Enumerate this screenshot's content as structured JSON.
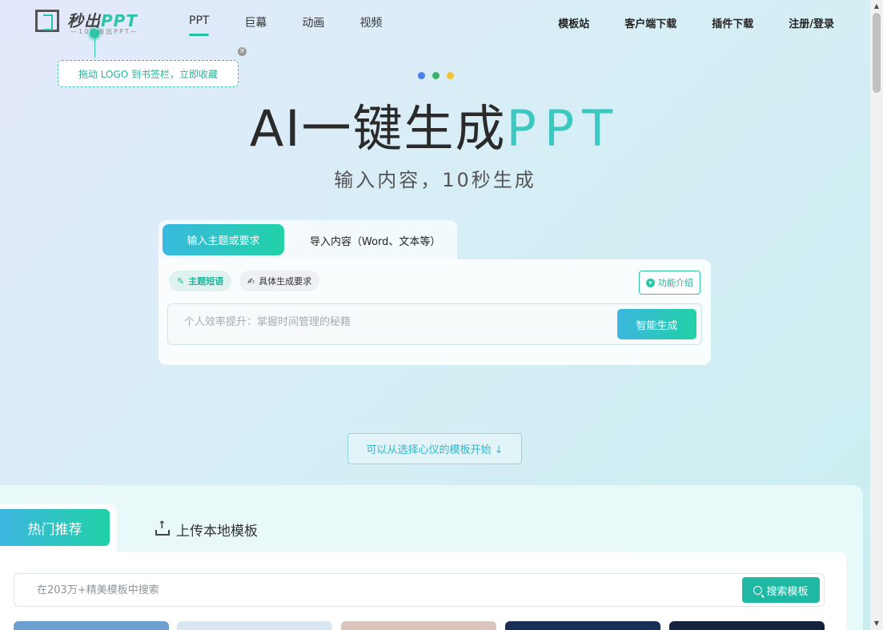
{
  "brand": {
    "name_cn": "秒出",
    "name_ppt": "PPT",
    "slogan": "—10秒做出PPT—"
  },
  "nav": {
    "left": [
      "PPT",
      "巨幕",
      "动画",
      "视频"
    ],
    "right": [
      "模板站",
      "客户端下载",
      "插件下载",
      "注册/登录"
    ]
  },
  "tooltip": {
    "text": "拖动 LOGO 到书签栏，立即收藏",
    "close": "×"
  },
  "hero": {
    "dots": [
      "#4a7ff0",
      "#3bb36a",
      "#f2c232"
    ],
    "title_main": "AI一键生成",
    "title_highlight": "PPT",
    "subtitle": "输入内容，10秒生成"
  },
  "generator": {
    "tab_active": "输入主题或要求",
    "tab_other": "导入内容（Word、文本等）",
    "chip_topic": "主题短语",
    "chip_detail": "具体生成要求",
    "feature_intro": "功能介绍",
    "input_placeholder": "个人效率提升：掌握时间管理的秘籍",
    "generate_button": "智能生成"
  },
  "choose_template": "可以从选择心仪的模板开始 ↓",
  "templates": {
    "tab_hot": "热门推荐",
    "tab_upload": "上传本地模板",
    "search_placeholder": "在203万+精美模板中搜索",
    "search_button": "搜索模板",
    "thumb_colors": [
      "#6d9fd0",
      "#d9e7f2",
      "#d9c5bd",
      "#1a2f55",
      "#14233e"
    ]
  },
  "scrollbar": {
    "up": "▲",
    "down": "▼"
  }
}
